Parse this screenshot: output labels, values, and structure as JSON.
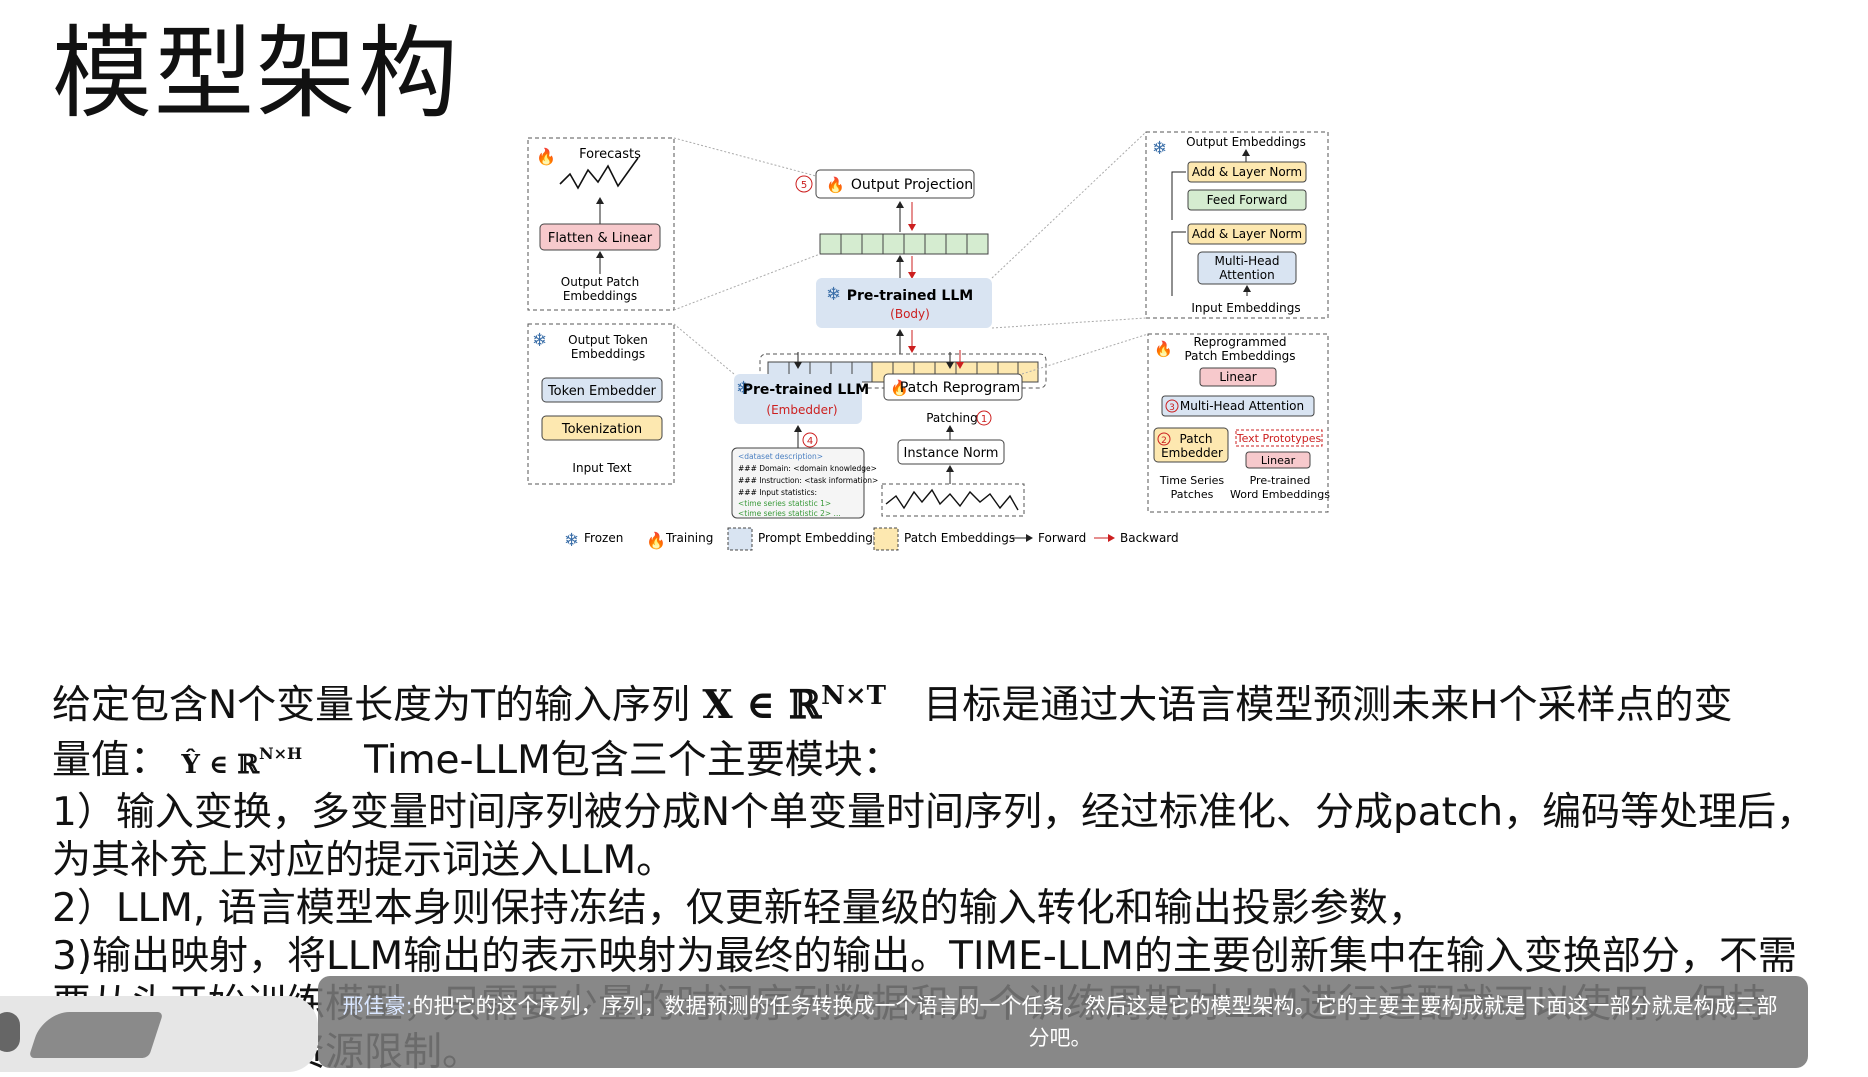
{
  "slide": {
    "title": "模型架构"
  },
  "figure": {
    "forecasts": "Forecasts",
    "flatten_linear": "Flatten & Linear",
    "output_patch_embeddings_1": "Output Patch",
    "output_patch_embeddings_2": "Embeddings",
    "output_projection": "Output Projection",
    "step5": "5",
    "pretrained_llm_body": "Pre-trained LLM",
    "body": "(Body)",
    "output_embeddings": "Output Embeddings",
    "add_layer_norm": "Add & Layer Norm",
    "feed_forward": "Feed Forward",
    "mha_1": "Multi-Head",
    "mha_2": "Attention",
    "input_embeddings": "Input Embeddings",
    "output_token_1": "Output Token",
    "output_token_2": "Embeddings",
    "token_embedder": "Token Embedder",
    "tokenization": "Tokenization",
    "input_text": "Input Text",
    "pretrained_llm_embedder": "Pre-trained LLM",
    "embedder": "(Embedder)",
    "step4": "4",
    "patch_reprogram": "Patch Reprogram",
    "patching": "Patching",
    "step1": "1",
    "instance_norm": "Instance Norm",
    "prompt_lines": [
      "<dataset description>",
      "### Domain: <domain knowledge>",
      "### Instruction: <task information>",
      "### Input statistics:",
      "<time series statistic 1>",
      "<time series statistic 2>  ..."
    ],
    "reprogrammed_1": "Reprogrammed",
    "reprogrammed_2": "Patch Embeddings",
    "linear": "Linear",
    "step3": "3",
    "mha_full": "Multi-Head Attention",
    "step2": "2",
    "patch_embedder_1": "Patch",
    "patch_embedder_2": "Embedder",
    "text_prototypes": "Text Prototypes",
    "time_series_1": "Time Series",
    "time_series_2": "Patches",
    "pretrained_word_1": "Pre-trained",
    "pretrained_word_2": "Word Embeddings",
    "legend": {
      "frozen": "Frozen",
      "training": "Training",
      "prompt_embeddings": "Prompt Embeddings",
      "patch_embeddings": "Patch Embeddings",
      "forward": "Forward",
      "backward": "Backward"
    },
    "colors": {
      "blue_box": "#d9e4f2",
      "yellow_box": "#fde8b0",
      "pink_box": "#f7c9cc",
      "green_box": "#d5ecd0",
      "red_arrow": "#cc1f1f"
    }
  },
  "body": {
    "line1_a": "给定包含N个变量长度为T的输入序列",
    "line1_math": "X ∈ ℝ",
    "line1_sup": "N×T",
    "line1_b": "目标是通过大语言模型预测未来H个采样点的变",
    "line2_a": "量值：",
    "line2_math": "Ŷ ∈ ℝ",
    "line2_sup": "N×H",
    "line2_b": "Time-LLM包含三个主要模块：",
    "line3": "1）输入变换，多变量时间序列被分成N个单变量时间序列，经过标准化、分成patch，编码等处理后，",
    "line4": "为其补充上对应的提示词送入LLM。",
    "line5": "2）LLM, 语言模型本身则保持冻结，仅更新轻量级的输入转化和输出投影参数，",
    "line6": "3)输出映射，将LLM输出的表示映射为最终的输出。TIME-LLM的主要创新集中在输入变换部分，不需",
    "line7": "要从头开始训练模型，只需要少量的时间序列数据和几个训练周期对LLM进行适配就可以使用，保持",
    "line8": "高效率并减少资源限制。"
  },
  "caption": {
    "speaker": "邢佳豪:",
    "text": "的把它的这个序列，序列，数据预测的任务转换成一个语言的一个任务。然后这是它的模型架构。它的主要主要构成就是下面这一部分就是构成三部分吧。"
  }
}
